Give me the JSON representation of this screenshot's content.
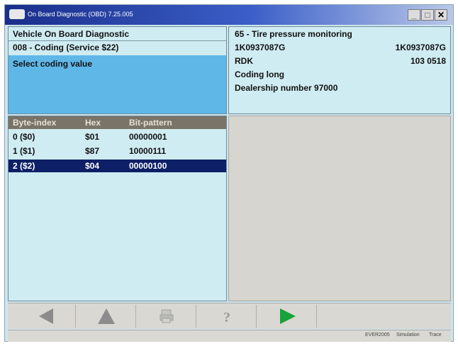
{
  "window": {
    "title": "On Board Diagnostic (OBD) 7.25.005",
    "controls": {
      "minimize": "_",
      "maximize": "□",
      "close": "✕"
    }
  },
  "left_header": {
    "line1": "Vehicle On Board Diagnostic",
    "line2": "008 - Coding (Service $22)",
    "prompt": "Select coding value"
  },
  "right_header": {
    "title": "65 - Tire pressure monitoring",
    "part_left": "1K0937087G",
    "part_right": "1K0937087G",
    "system": "RDK",
    "system_value": "103  0518",
    "coding": "Coding long",
    "dealership": "Dealership number 97000"
  },
  "table": {
    "headers": [
      "Byte-index",
      "Hex",
      "Bit-pattern"
    ],
    "rows": [
      [
        "0  ($0)",
        "$01",
        "00000001"
      ],
      [
        "1  ($1)",
        "$87",
        "10000111"
      ],
      [
        "2  ($2)",
        "$04",
        "00000100"
      ]
    ],
    "selected_row": 2
  },
  "toolbar": {
    "icons": [
      "arrow-left-icon",
      "arrow-up-icon",
      "print-icon",
      "help-icon",
      "play-icon"
    ],
    "colors": {
      "active_go": "#17a23a",
      "disabled": "#8c8c8c"
    }
  },
  "statusbar": {
    "items": [
      "EVER2005",
      "Simulation",
      "Trace"
    ]
  }
}
